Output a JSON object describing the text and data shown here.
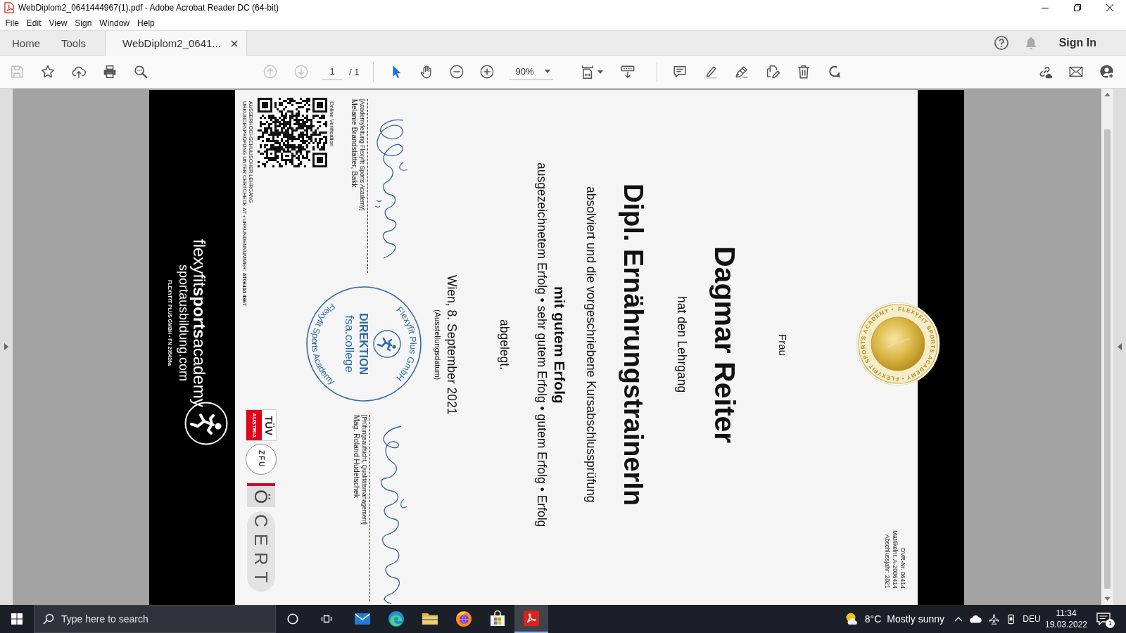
{
  "window": {
    "title": "WebDiplom2_0641444967(1).pdf - Adobe Acrobat Reader DC (64-bit)"
  },
  "menu": [
    {
      "label": "File"
    },
    {
      "label": "Edit"
    },
    {
      "label": "View"
    },
    {
      "label": "Sign"
    },
    {
      "label": "Window"
    },
    {
      "label": "Help"
    }
  ],
  "tabs": [
    {
      "label": "Home",
      "selected": false,
      "closable": false
    },
    {
      "label": "Tools",
      "selected": false,
      "closable": false
    },
    {
      "label": "WebDiplom2_0641...",
      "selected": true,
      "closable": true
    }
  ],
  "account": {
    "sign_in": "Sign In"
  },
  "toolbar": {
    "save": {
      "disabled": true
    },
    "previous_page": {
      "disabled": true
    },
    "next_page": {
      "disabled": true
    },
    "page_field": {
      "value": "1"
    },
    "page_total": "/ 1",
    "select_tool": {
      "selected": true
    },
    "hand_tool": {
      "selected": false
    },
    "zoom_field": {
      "value": "90%"
    }
  },
  "certificate": {
    "registry": [
      "DVR-Nr. 06414",
      "Matrikelnr. A-2006414",
      "Abschlussjahr: 2021"
    ],
    "lines": [
      {
        "kind": "salutation",
        "text": "Frau"
      },
      {
        "kind": "name",
        "text": "Dagmar Reiter"
      },
      {
        "kind": "text",
        "text": "hat den Lehrgang"
      },
      {
        "kind": "title",
        "text": "Dipl. ErnährungstrainerIn"
      },
      {
        "kind": "text",
        "text": "absolviert und die vorgeschriebene Kursabschlussprüfung"
      },
      {
        "kind": "grade",
        "text": "mit gutem Erfolg"
      },
      {
        "kind": "text",
        "text": "ausgezeichnetem Erfolg • sehr gutem Erfolg • gutem Erfolg • Erfolg"
      },
      {
        "kind": "text",
        "text": "abgelegt."
      },
      {
        "kind": "date",
        "text": "Wien, 8. September 2021"
      },
      {
        "kind": "caption",
        "text": "(Ausstellungsdatum)"
      }
    ],
    "signatures": [
      {
        "role": "[Academyleitung Flexyfit Sports Academy]",
        "name": "Melanie Brandstätter, Bakk"
      },
      {
        "role": "[Prüfungsaufsicht, Qualitätsmanagement]",
        "name": "Mag. Roland Hudetschek"
      }
    ],
    "stamp": {
      "top_arc": "Flexyfit Plus GmbH",
      "bottom_arc": "Flexyfit Sports Academy",
      "title": "DIREKTION",
      "subtitle": "fsa.college"
    },
    "verification": {
      "label": "Online Verification",
      "course_type": "AUSSERHOCHSCHULISCHER LEHRGANG",
      "check": "URKUNDENPRÜFUNG UNTER CERTCHECK.AT • URKUNDENNUMMER: **AT06414 4967**"
    },
    "logos": {
      "tuv": "TÜV",
      "tuv_country": "AUSTRIA",
      "zfu": "ZFU",
      "oecert_letter": "Ö",
      "oecert_word": "CERT"
    },
    "brand": {
      "name": "flexyfit**sports**academy",
      "website": "sportausbildung.com",
      "company": "FLEXYFIT PLUS GMBH • FN 295426a"
    },
    "seal": {
      "ring_text": "FLEXYFIT SPORTS ACADEMY • FLEXYFIT SPORTS ACADEMY •"
    }
  },
  "taskbar": {
    "search": {
      "placeholder": "Type here to search"
    },
    "apps": [
      {
        "selected": false
      },
      {
        "selected": false
      },
      {
        "selected": false
      },
      {
        "selected": false
      },
      {
        "selected": false
      },
      {
        "selected": true
      }
    ],
    "weather": {
      "temperature": "8°C",
      "condition": "Mostly sunny"
    },
    "language": "DEU",
    "clock": {
      "time": "11:34",
      "date": "19.03.2022"
    },
    "notifications": {
      "count": "1"
    }
  }
}
